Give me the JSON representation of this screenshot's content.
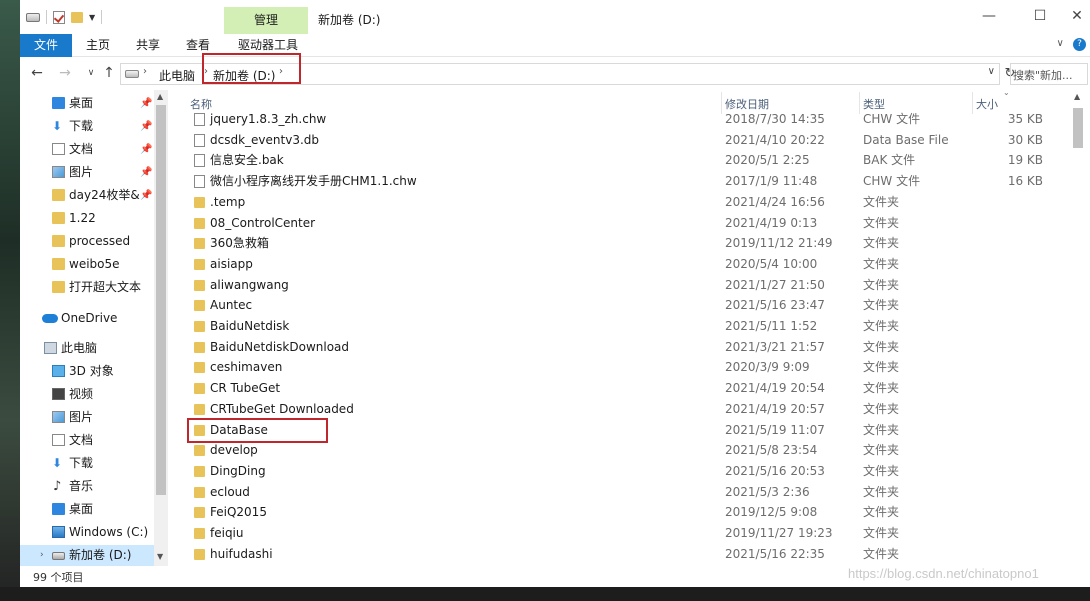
{
  "titlebar": {
    "manage_tab": "管理",
    "title": "新加卷 (D:)",
    "minimize": "—",
    "maximize": "☐",
    "close": "✕"
  },
  "ribbon": {
    "tabs": [
      "文件",
      "主页",
      "共享",
      "查看",
      "驱动器工具"
    ],
    "collapse": "∨",
    "help": "?"
  },
  "address": {
    "crumbs": [
      "此电脑",
      "新加卷 (D:)"
    ],
    "search_placeholder": "搜索\"新加..."
  },
  "nav": {
    "quick_access": [
      {
        "label": "桌面",
        "icon": "desktop-icon",
        "pinned": true
      },
      {
        "label": "下载",
        "icon": "download-icon",
        "pinned": true
      },
      {
        "label": "文档",
        "icon": "document-icon",
        "pinned": true
      },
      {
        "label": "图片",
        "icon": "picture-icon",
        "pinned": true
      },
      {
        "label": "day24枚举&",
        "icon": "folder-icon",
        "pinned": true
      },
      {
        "label": "1.22",
        "icon": "folder-icon",
        "pinned": false
      },
      {
        "label": "processed",
        "icon": "folder-icon",
        "pinned": false
      },
      {
        "label": "weibo5e",
        "icon": "folder-icon",
        "pinned": false
      },
      {
        "label": "打开超大文本",
        "icon": "folder-icon",
        "pinned": false
      }
    ],
    "onedrive": "OneDrive",
    "this_pc": "此电脑",
    "pc_items": [
      {
        "label": "3D 对象",
        "icon": "3d-objects-icon"
      },
      {
        "label": "视频",
        "icon": "video-icon"
      },
      {
        "label": "图片",
        "icon": "picture-icon"
      },
      {
        "label": "文档",
        "icon": "document-icon"
      },
      {
        "label": "下载",
        "icon": "download-icon"
      },
      {
        "label": "音乐",
        "icon": "music-icon"
      },
      {
        "label": "桌面",
        "icon": "desktop-icon"
      },
      {
        "label": "Windows (C:)",
        "icon": "windows-drive-icon"
      },
      {
        "label": "新加卷 (D:)",
        "icon": "drive-icon"
      }
    ]
  },
  "columns": {
    "name": "名称",
    "date": "修改日期",
    "type": "类型",
    "size": "大小"
  },
  "files": [
    {
      "name": "jquery1.8.3_zh.chw",
      "date": "2018/7/30 14:35",
      "type": "CHW 文件",
      "size": "35 KB",
      "kind": "file"
    },
    {
      "name": "dcsdk_eventv3.db",
      "date": "2021/4/10 20:22",
      "type": "Data Base File",
      "size": "30 KB",
      "kind": "file"
    },
    {
      "name": "信息安全.bak",
      "date": "2020/5/1 2:25",
      "type": "BAK 文件",
      "size": "19 KB",
      "kind": "file"
    },
    {
      "name": "微信小程序离线开发手册CHM1.1.chw",
      "date": "2017/1/9 11:48",
      "type": "CHW 文件",
      "size": "16 KB",
      "kind": "file"
    },
    {
      "name": ".temp",
      "date": "2021/4/24 16:56",
      "type": "文件夹",
      "size": "",
      "kind": "folder"
    },
    {
      "name": "08_ControlCenter",
      "date": "2021/4/19 0:13",
      "type": "文件夹",
      "size": "",
      "kind": "folder"
    },
    {
      "name": "360急救箱",
      "date": "2019/11/12 21:49",
      "type": "文件夹",
      "size": "",
      "kind": "folder"
    },
    {
      "name": "aisiapp",
      "date": "2020/5/4 10:00",
      "type": "文件夹",
      "size": "",
      "kind": "folder"
    },
    {
      "name": "aliwangwang",
      "date": "2021/1/27 21:50",
      "type": "文件夹",
      "size": "",
      "kind": "folder"
    },
    {
      "name": "Auntec",
      "date": "2021/5/16 23:47",
      "type": "文件夹",
      "size": "",
      "kind": "folder"
    },
    {
      "name": "BaiduNetdisk",
      "date": "2021/5/11 1:52",
      "type": "文件夹",
      "size": "",
      "kind": "folder"
    },
    {
      "name": "BaiduNetdiskDownload",
      "date": "2021/3/21 21:57",
      "type": "文件夹",
      "size": "",
      "kind": "folder"
    },
    {
      "name": "ceshimaven",
      "date": "2020/3/9 9:09",
      "type": "文件夹",
      "size": "",
      "kind": "folder"
    },
    {
      "name": "CR TubeGet",
      "date": "2021/4/19 20:54",
      "type": "文件夹",
      "size": "",
      "kind": "folder"
    },
    {
      "name": "CRTubeGet Downloaded",
      "date": "2021/4/19 20:57",
      "type": "文件夹",
      "size": "",
      "kind": "folder"
    },
    {
      "name": "DataBase",
      "date": "2021/5/19 11:07",
      "type": "文件夹",
      "size": "",
      "kind": "folder"
    },
    {
      "name": "develop",
      "date": "2021/5/8 23:54",
      "type": "文件夹",
      "size": "",
      "kind": "folder"
    },
    {
      "name": "DingDing",
      "date": "2021/5/16 20:53",
      "type": "文件夹",
      "size": "",
      "kind": "folder"
    },
    {
      "name": "ecloud",
      "date": "2021/5/3 2:36",
      "type": "文件夹",
      "size": "",
      "kind": "folder"
    },
    {
      "name": "FeiQ2015",
      "date": "2019/12/5 9:08",
      "type": "文件夹",
      "size": "",
      "kind": "folder"
    },
    {
      "name": "feiqiu",
      "date": "2019/11/27 19:23",
      "type": "文件夹",
      "size": "",
      "kind": "folder"
    },
    {
      "name": "huifudashi",
      "date": "2021/5/16 22:35",
      "type": "文件夹",
      "size": "",
      "kind": "folder"
    }
  ],
  "status": {
    "count": "99 个项目",
    "watermark": "https://blog.csdn.net/chinatopno1"
  },
  "colors": {
    "accent": "#1979ca",
    "manage_tab": "#d4efb5",
    "highlight_box": "#c0272d",
    "folder": "#e8c35a",
    "selected": "#cce8ff"
  }
}
